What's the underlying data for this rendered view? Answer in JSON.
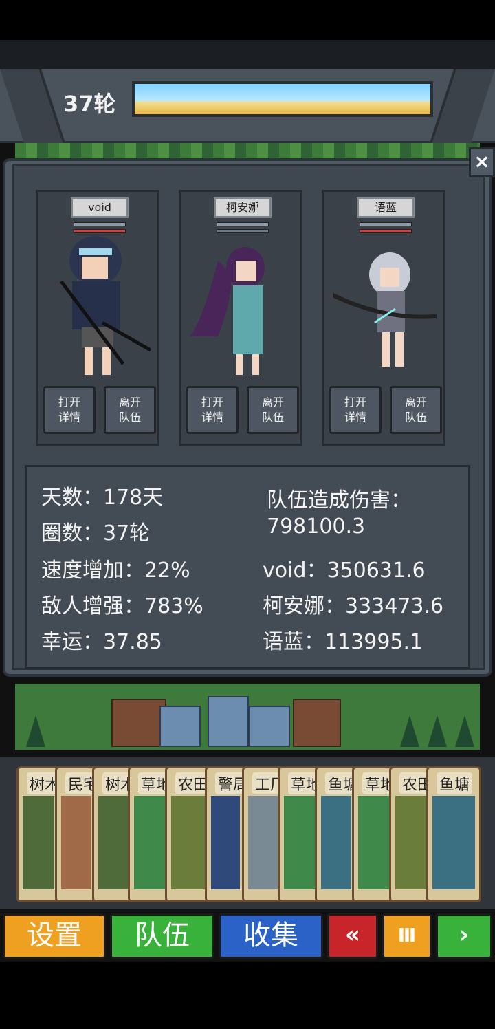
{
  "header": {
    "round": "37轮"
  },
  "close_label": "×",
  "party": [
    {
      "name": "void",
      "btn_details": [
        "打开",
        "详情"
      ],
      "btn_leave": [
        "离开",
        "队伍"
      ]
    },
    {
      "name": "柯安娜",
      "btn_details": [
        "打开",
        "详情"
      ],
      "btn_leave": [
        "离开",
        "队伍"
      ]
    },
    {
      "name": "语蓝",
      "btn_details": [
        "打开",
        "详情"
      ],
      "btn_leave": [
        "离开",
        "队伍"
      ]
    }
  ],
  "stats": {
    "days": "天数：178天",
    "loops": "圈数：37轮",
    "speed": "速度增加：22%",
    "enemy": "敌人增强：783%",
    "luck": "幸运：37.85",
    "damage_title": "队伍造成伤害：",
    "damage_total": "798100.3",
    "damage_void": "void：350631.6",
    "damage_keanna": "柯安娜：333473.6",
    "damage_yulan": "语蓝：113995.1"
  },
  "terrain_cards": [
    {
      "label": "树木",
      "color": "#4f6b3a"
    },
    {
      "label": "民宅",
      "color": "#a06a48"
    },
    {
      "label": "树木",
      "color": "#4f6b3a"
    },
    {
      "label": "草地",
      "color": "#3f8a4a"
    },
    {
      "label": "农田",
      "color": "#6a7d3a"
    },
    {
      "label": "警局",
      "color": "#2f4a7a"
    },
    {
      "label": "工厂",
      "color": "#7a8a94"
    },
    {
      "label": "草地",
      "color": "#3f8a4a"
    },
    {
      "label": "鱼塘",
      "color": "#3b6f82"
    },
    {
      "label": "草地",
      "color": "#3f8a4a"
    },
    {
      "label": "农田",
      "color": "#6a7d3a"
    },
    {
      "label": "鱼塘",
      "color": "#3b6f82"
    }
  ],
  "toolbar": {
    "settings": "设置",
    "team": "队伍",
    "collect": "收集",
    "rewind": "«",
    "pause": "Ⅲ",
    "forward": "›"
  },
  "colors": {
    "settings": "#f0a020",
    "team": "#38b23a",
    "collect": "#2a62c8",
    "rewind": "#c8252a",
    "pause": "#f0a020",
    "forward": "#38b23a"
  }
}
